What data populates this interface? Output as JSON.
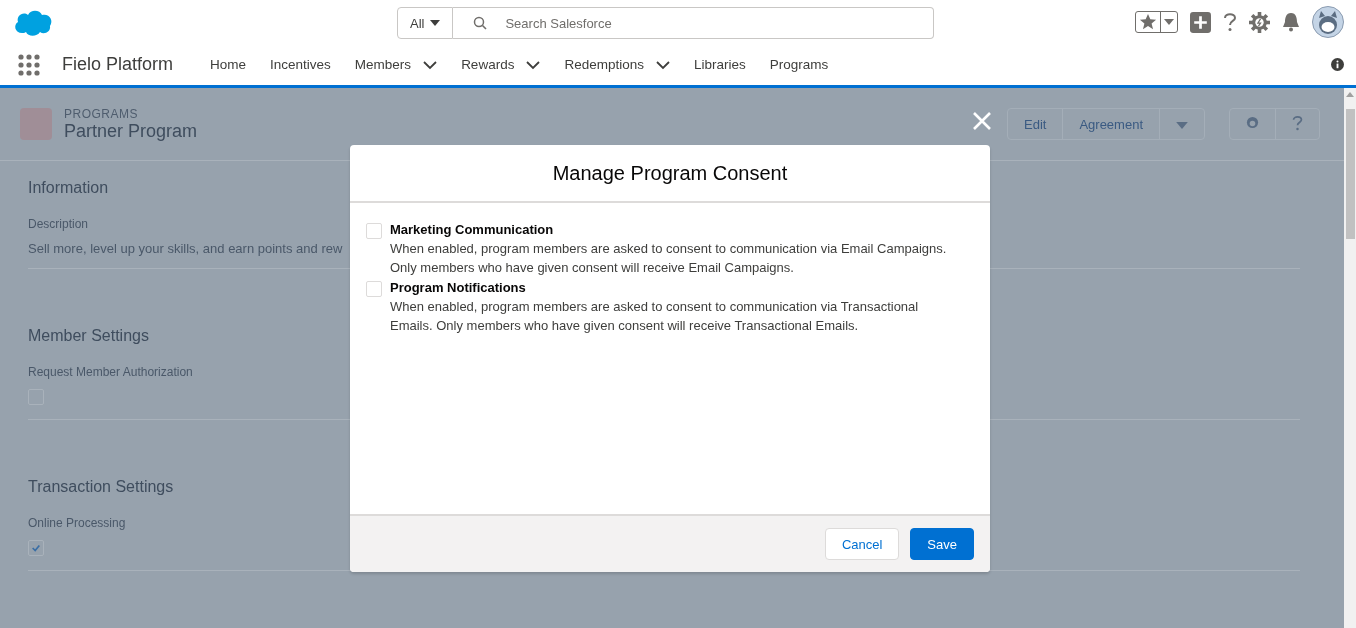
{
  "header": {
    "search": {
      "scope": "All",
      "placeholder": "Search Salesforce"
    }
  },
  "nav": {
    "app_name": "Fielo Platform",
    "items": [
      {
        "label": "Home",
        "dropdown": false
      },
      {
        "label": "Incentives",
        "dropdown": false
      },
      {
        "label": "Members",
        "dropdown": true
      },
      {
        "label": "Rewards",
        "dropdown": true
      },
      {
        "label": "Redemptions",
        "dropdown": true
      },
      {
        "label": "Libraries",
        "dropdown": false
      },
      {
        "label": "Programs",
        "dropdown": false
      }
    ]
  },
  "record": {
    "object_type": "PROGRAMS",
    "title": "Partner Program",
    "actions": [
      "Edit",
      "Agreement"
    ],
    "sections": [
      {
        "title": "Information",
        "fields": [
          {
            "label": "Description",
            "kind": "text",
            "value": "Sell more, level up your skills, and earn points and rew"
          }
        ]
      },
      {
        "title": "Member Settings",
        "fields": [
          {
            "label": "Request Member Authorization",
            "kind": "checkbox",
            "checked": false
          }
        ]
      },
      {
        "title": "Transaction Settings",
        "fields": [
          {
            "label": "Online Processing",
            "kind": "checkbox",
            "checked": true
          }
        ]
      }
    ]
  },
  "modal": {
    "title": "Manage Program Consent",
    "options": [
      {
        "label": "Marketing Communication",
        "description": "When enabled, program members are asked to consent to communication via Email Campaigns. Only members who have given consent will receive Email Campaigns.",
        "checked": false
      },
      {
        "label": "Program Notifications",
        "description": "When enabled, program members are asked to consent to communication via Transactional Emails. Only members who have given consent will receive Transactional Emails.",
        "checked": false
      }
    ],
    "buttons": [
      {
        "label": "Cancel",
        "kind": "neutral"
      },
      {
        "label": "Save",
        "kind": "brand"
      }
    ]
  }
}
